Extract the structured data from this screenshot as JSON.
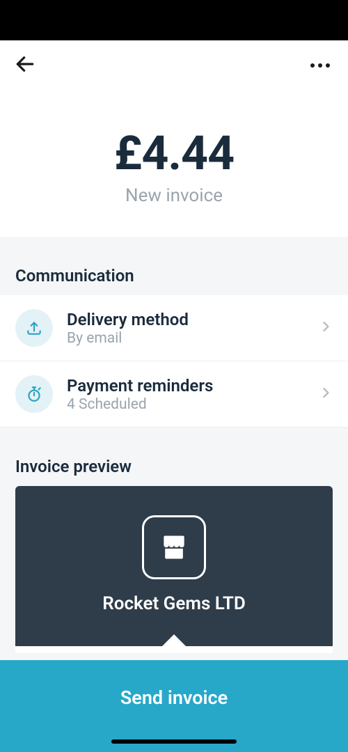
{
  "amount": {
    "value": "£4.44",
    "label": "New invoice"
  },
  "sections": {
    "communication": {
      "header": "Communication",
      "items": {
        "delivery": {
          "title": "Delivery method",
          "sub": "By email"
        },
        "reminders": {
          "title": "Payment reminders",
          "sub": "4 Scheduled"
        }
      }
    },
    "preview": {
      "header": "Invoice preview",
      "company": "Rocket Gems LTD"
    }
  },
  "cta": "Send invoice"
}
